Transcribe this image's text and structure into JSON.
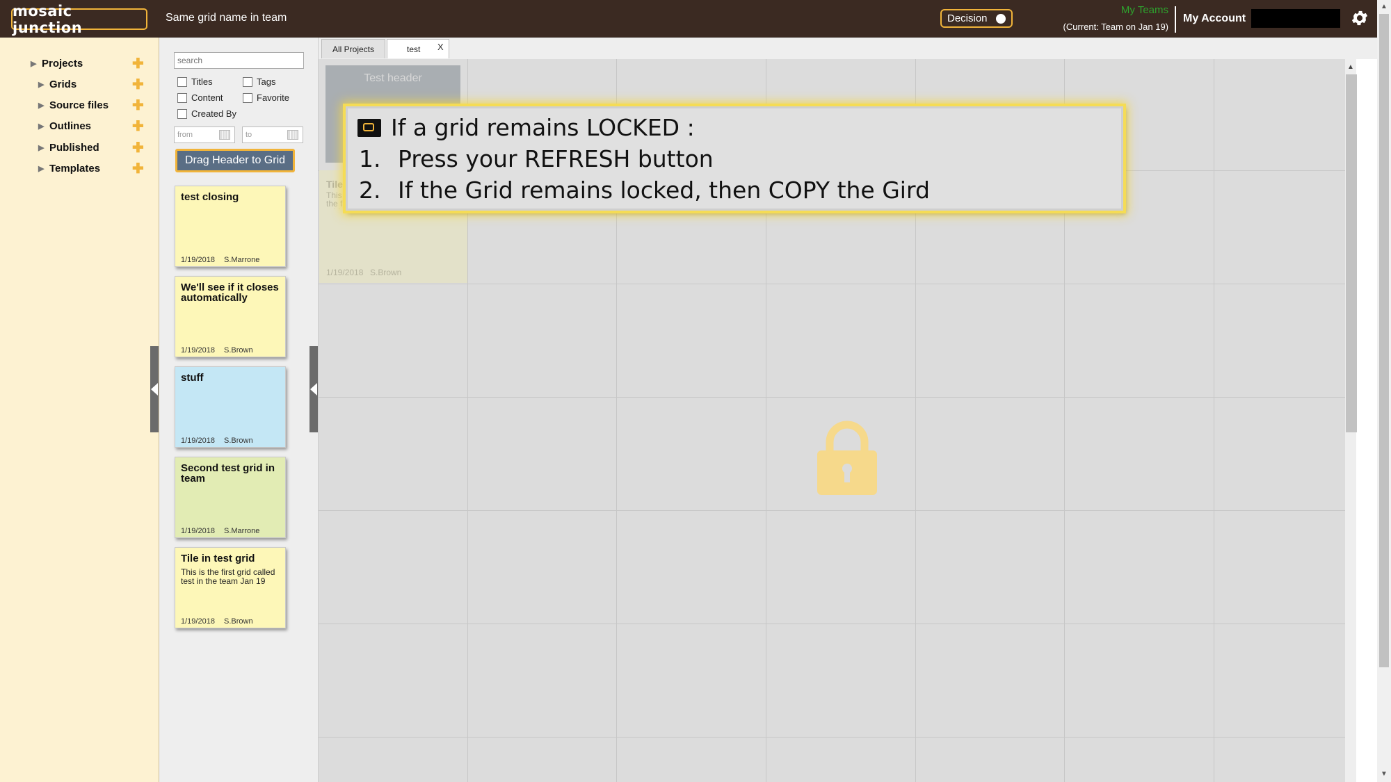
{
  "header": {
    "logo_text": "MOSAIC JUNCTION",
    "grid_name": "Same grid name in team",
    "decision_label": "Decision",
    "my_teams": "My Teams",
    "current_team": "(Current: Team on Jan 19)",
    "my_account": "My Account"
  },
  "nav": {
    "items": [
      {
        "label": "Projects"
      },
      {
        "label": "Grids"
      },
      {
        "label": "Source files"
      },
      {
        "label": "Outlines"
      },
      {
        "label": "Published"
      },
      {
        "label": "Templates"
      }
    ],
    "plus": "✚"
  },
  "filter": {
    "search_placeholder": "search",
    "titles": "Titles",
    "tags": "Tags",
    "content": "Content",
    "favorite": "Favorite",
    "created_by": "Created By",
    "from_placeholder": "from",
    "to_placeholder": "to",
    "drag_button": "Drag Header to Grid"
  },
  "tiles": [
    {
      "title": "test closing",
      "body": "",
      "date": "1/19/2018",
      "author": "S.Marrone",
      "color": "#fdf7b8"
    },
    {
      "title": "We'll see if it closes automatically",
      "body": "",
      "date": "1/19/2018",
      "author": "S.Brown",
      "color": "#fdf7b8"
    },
    {
      "title": "stuff",
      "body": "",
      "date": "1/19/2018",
      "author": "S.Brown",
      "color": "#c4e7f5"
    },
    {
      "title": "Second test grid in team",
      "body": "",
      "date": "1/19/2018",
      "author": "S.Marrone",
      "color": "#e2ecb4"
    },
    {
      "title": "Tile in test grid",
      "body": "This is the first grid called test in the team Jan 19",
      "date": "1/19/2018",
      "author": "S.Brown",
      "color": "#fdf7b8"
    }
  ],
  "tabs": {
    "all_projects": "All Projects",
    "current": "test",
    "close": "X"
  },
  "grid": {
    "header_tile": "Test header",
    "cell_tile": {
      "title": "Tile",
      "body": "This is the first grid called test in the team Jan 19",
      "date": "1/19/2018",
      "author": "S.Brown"
    }
  },
  "alert": {
    "title": "If a grid remains LOCKED :",
    "steps": [
      {
        "num": "1.",
        "text": "Press your REFRESH button"
      },
      {
        "num": "2.",
        "text": "If the Grid remains locked, then COPY the Gird"
      }
    ]
  },
  "colors": {
    "header_bg": "#3b2a22",
    "accent": "#f1b43a",
    "nav_bg": "#fdf2d2",
    "grid_bg": "#dcdcdc",
    "alert_glow": "#f5dc55"
  },
  "icons": [
    "gear-icon",
    "lock-icon",
    "calendar-icon",
    "refresh-icon",
    "expand-arrow-icon"
  ]
}
